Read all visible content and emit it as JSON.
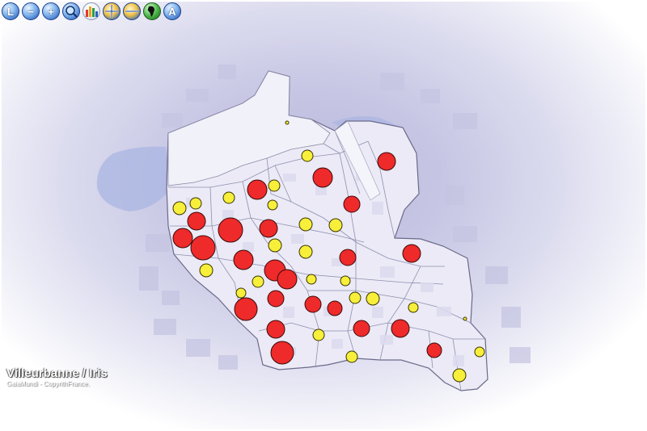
{
  "toolbar": {
    "buttons": [
      {
        "label": "L",
        "icon": "layers-icon"
      },
      {
        "label": "−",
        "icon": "zoom-out-icon"
      },
      {
        "label": "+",
        "icon": "zoom-in-icon"
      },
      {
        "label": "",
        "icon": "zoom-extent-icon"
      },
      {
        "label": "",
        "icon": "chart-bars-icon"
      },
      {
        "label": "",
        "icon": "add-layer-icon"
      },
      {
        "label": "",
        "icon": "remove-layer-icon"
      },
      {
        "label": "",
        "icon": "world-map-icon"
      },
      {
        "label": "A",
        "icon": "labels-icon"
      }
    ]
  },
  "map": {
    "title": "Villeurbanne / Iris",
    "copyright": "GaiaMundi - CopyrithFrance.",
    "colors": {
      "red_symbol": "#ee2a2a",
      "yellow_symbol": "#f7ef3a",
      "territory_fill": "#ebeaf6",
      "boundary": "#6a6a8a",
      "water": "#a9b5e2"
    }
  }
}
